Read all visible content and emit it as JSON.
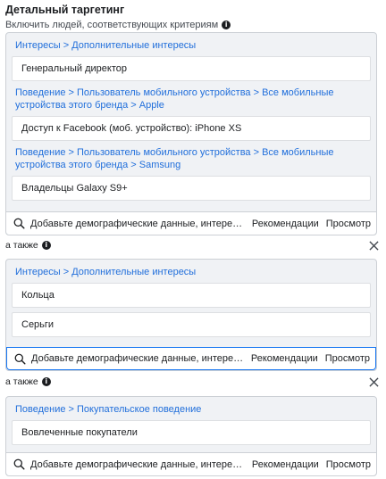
{
  "header": {
    "title": "Детальный таргетинг",
    "subtitle": "Включить людей, соответствующих критериям"
  },
  "groups": [
    {
      "entries": [
        {
          "crumb": "Интересы > Дополнительные интересы",
          "item": "Генеральный директор"
        },
        {
          "crumb": "Поведение > Пользователь мобильного устройства > Все мобильные устройства этого бренда > Apple",
          "item": "Доступ к Facebook (моб. устройство): iPhone XS"
        },
        {
          "crumb": "Поведение > Пользователь мобильного устройства > Все мобильные устройства этого бренда > Samsung",
          "item": "Владельцы Galaxy S9+"
        }
      ]
    },
    {
      "entries": [
        {
          "crumb": "Интересы > Дополнительные интересы",
          "items": [
            "Кольца",
            "Серьги"
          ]
        }
      ]
    },
    {
      "entries": [
        {
          "crumb": "Поведение > Покупательское поведение",
          "items": [
            "Вовлеченные покупатели"
          ]
        }
      ]
    }
  ],
  "search": {
    "placeholder": "Добавьте демографические данные, интересы и...",
    "recommendations": "Рекомендации",
    "browse": "Просмотр"
  },
  "also_label": "а также",
  "icons": {
    "info": "info-icon",
    "close": "close-icon",
    "search": "search-icon"
  }
}
